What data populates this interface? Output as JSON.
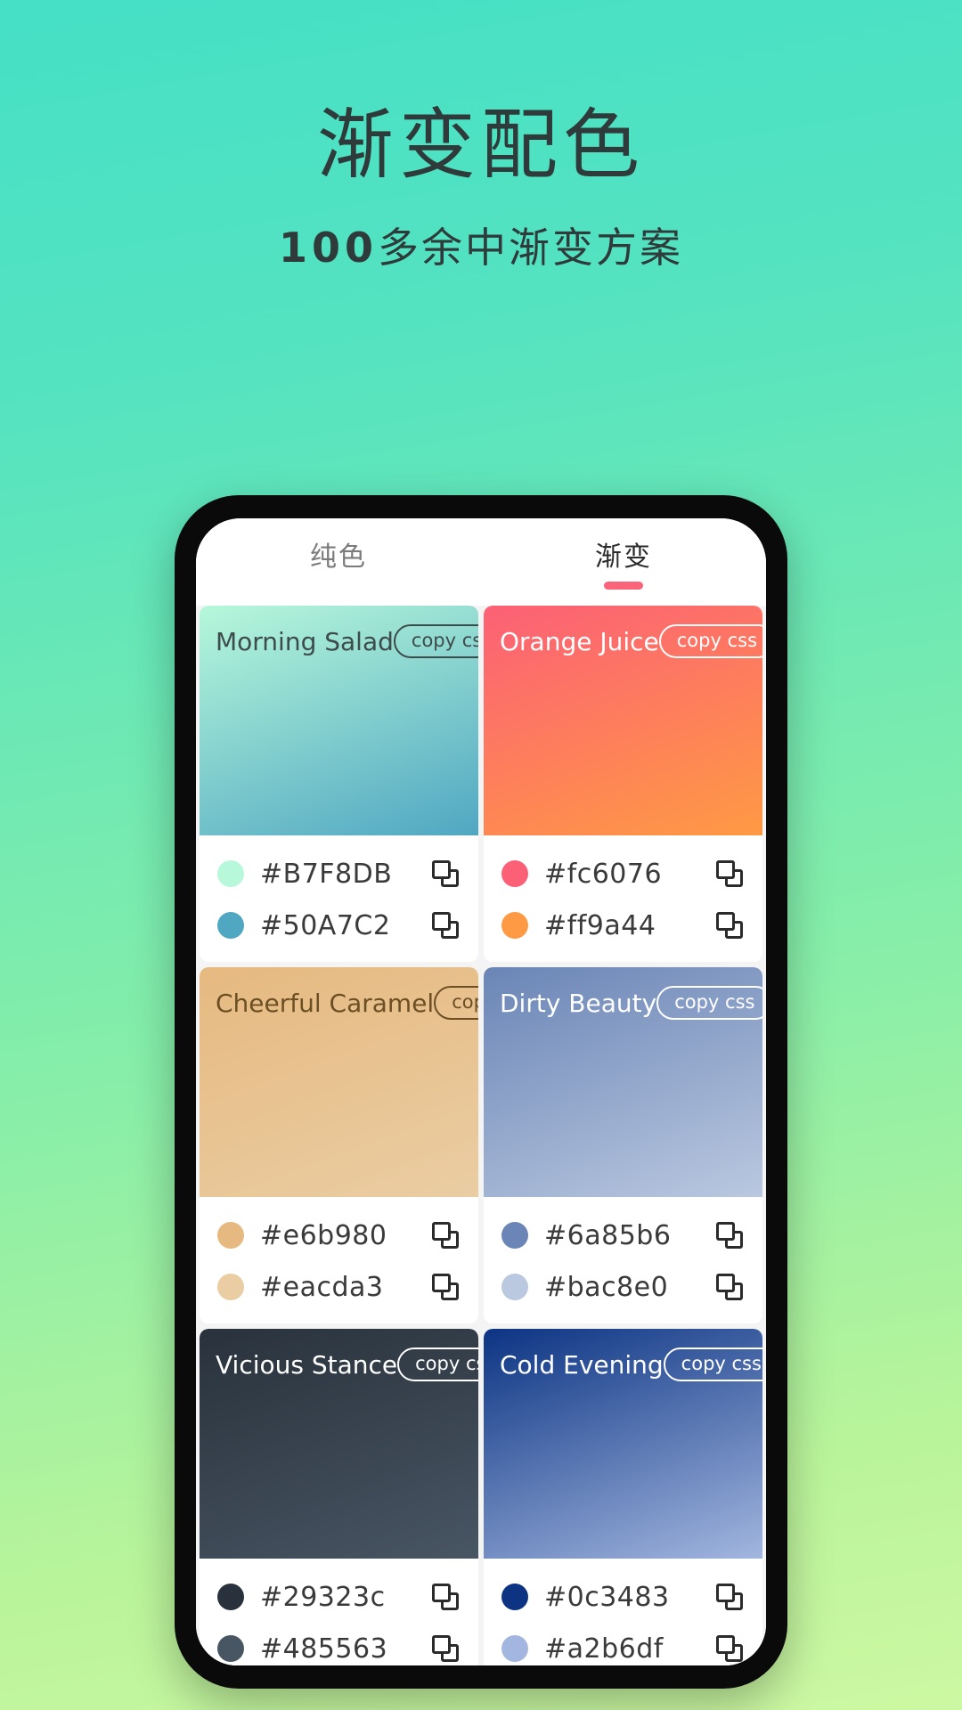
{
  "hero": {
    "title": "渐变配色",
    "subtitle_number": "100",
    "subtitle_rest": "多余中渐变方案"
  },
  "phone": {
    "tabs": [
      {
        "label": "纯色",
        "active": false
      },
      {
        "label": "渐变",
        "active": true
      }
    ],
    "copy_css_label": "copy css",
    "cards": [
      {
        "name": "Morning Salad",
        "colors": [
          "#B7F8DB",
          "#50A7C2"
        ],
        "text_mode": "dark"
      },
      {
        "name": "Orange Juice",
        "colors": [
          "#fc6076",
          "#ff9a44"
        ],
        "text_mode": "light"
      },
      {
        "name": "Cheerful Caramel",
        "colors": [
          "#e6b980",
          "#eacda3"
        ],
        "text_mode": "brown"
      },
      {
        "name": "Dirty Beauty",
        "colors": [
          "#6a85b6",
          "#bac8e0"
        ],
        "text_mode": "light"
      },
      {
        "name": "Vicious Stance",
        "colors": [
          "#29323c",
          "#485563"
        ],
        "text_mode": "light"
      },
      {
        "name": "Cold Evening",
        "colors": [
          "#0c3483",
          "#a2b6df"
        ],
        "text_mode": "light"
      }
    ]
  },
  "theme": {
    "bg_top": "#45e0c6",
    "bg_bottom": "#cdf8a3",
    "accent": "#f9647a"
  }
}
